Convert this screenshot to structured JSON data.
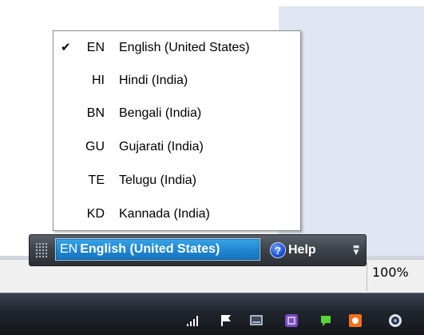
{
  "menu": {
    "items": [
      {
        "checked": "✔",
        "code": "EN",
        "name": "English (United States)"
      },
      {
        "checked": "",
        "code": "HI",
        "name": "Hindi (India)"
      },
      {
        "checked": "",
        "code": "BN",
        "name": "Bengali (India)"
      },
      {
        "checked": "",
        "code": "GU",
        "name": "Gujarati (India)"
      },
      {
        "checked": "",
        "code": "TE",
        "name": "Telugu (India)"
      },
      {
        "checked": "",
        "code": "KD",
        "name": "Kannada (India)"
      }
    ]
  },
  "langbar": {
    "current_code": "EN",
    "current_name": "English (United States)",
    "help_label": "Help",
    "help_icon": "?",
    "options_icon": "options-arrow-icon"
  },
  "status": {
    "zoom": "100%"
  },
  "tray": {
    "icons": [
      "signal-bars-icon",
      "action-center-flag-icon",
      "display-icon",
      "note-app-icon",
      "chat-app-icon",
      "antivirus-icon",
      "media-app-icon"
    ]
  },
  "colors": {
    "lang_button": "#1e86d2",
    "langbar_bg": "#3d4249",
    "taskbar_bg": "#20252d",
    "help_icon": "#1b4fd6"
  }
}
